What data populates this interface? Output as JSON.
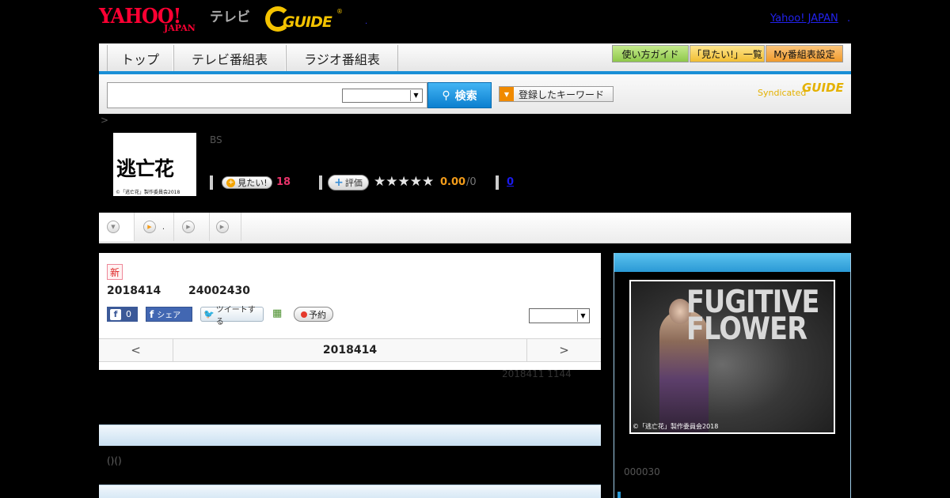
{
  "header": {
    "yahoo_logo": "YAHOO!",
    "yahoo_sub": "JAPAN",
    "tv_label": "テレビ",
    "gguide_logo": "GUIDE",
    "gguide_reg": "®",
    "dot": ".",
    "yahoo_japan_link": "Yahoo! JAPAN",
    "right_dot": "."
  },
  "nav": {
    "tabs": [
      {
        "label": "トップ"
      },
      {
        "label": "テレビ番組表"
      },
      {
        "label": "ラジオ番組表"
      }
    ],
    "utility": [
      {
        "label": "使い方ガイド",
        "color": "#9fd25a"
      },
      {
        "label": "「見たい!」一覧",
        "color": "#f6c544"
      },
      {
        "label": "My番組表設定",
        "color": "#f3a33a"
      }
    ]
  },
  "search": {
    "input_value": "",
    "select_value": "",
    "button_label": "検索",
    "keyword_button_label": "登録したキーワード",
    "syndicated_label": "Syndicated",
    "syndicated_logo": "GUIDE"
  },
  "breadcrumb": ">",
  "program": {
    "thumbnail_title": "逃亡花",
    "thumbnail_credit": "©「逃亡花」製作委員会2018",
    "channel": "BS",
    "mitai_label": "見たい!",
    "mitai_count": "18",
    "hyouka_label": "評価",
    "stars": "★★★★★",
    "rating_count": 0,
    "score": "0.00",
    "score_max": "/0",
    "review_count": "0"
  },
  "subtabs": [
    {
      "label": ""
    },
    {
      "label": "."
    },
    {
      "label": ""
    },
    {
      "label": ""
    }
  ],
  "broadcast": {
    "new_badge": "新",
    "date": "2018414",
    "time": "24002430",
    "fb_like_count": "0",
    "fb_share_label": "シェア",
    "tweet_label": "ツイートする",
    "reserve_label": "予約",
    "select_value": "",
    "pager_prev": "<",
    "pager_date": "2018414",
    "pager_next": ">"
  },
  "updated": "2018411  1144",
  "section_text": "()()",
  "side": {
    "poster_title": "FUGITIVE FLOWER",
    "poster_credit": "©「逃亡花」製作委員会2018",
    "number": "000030"
  }
}
